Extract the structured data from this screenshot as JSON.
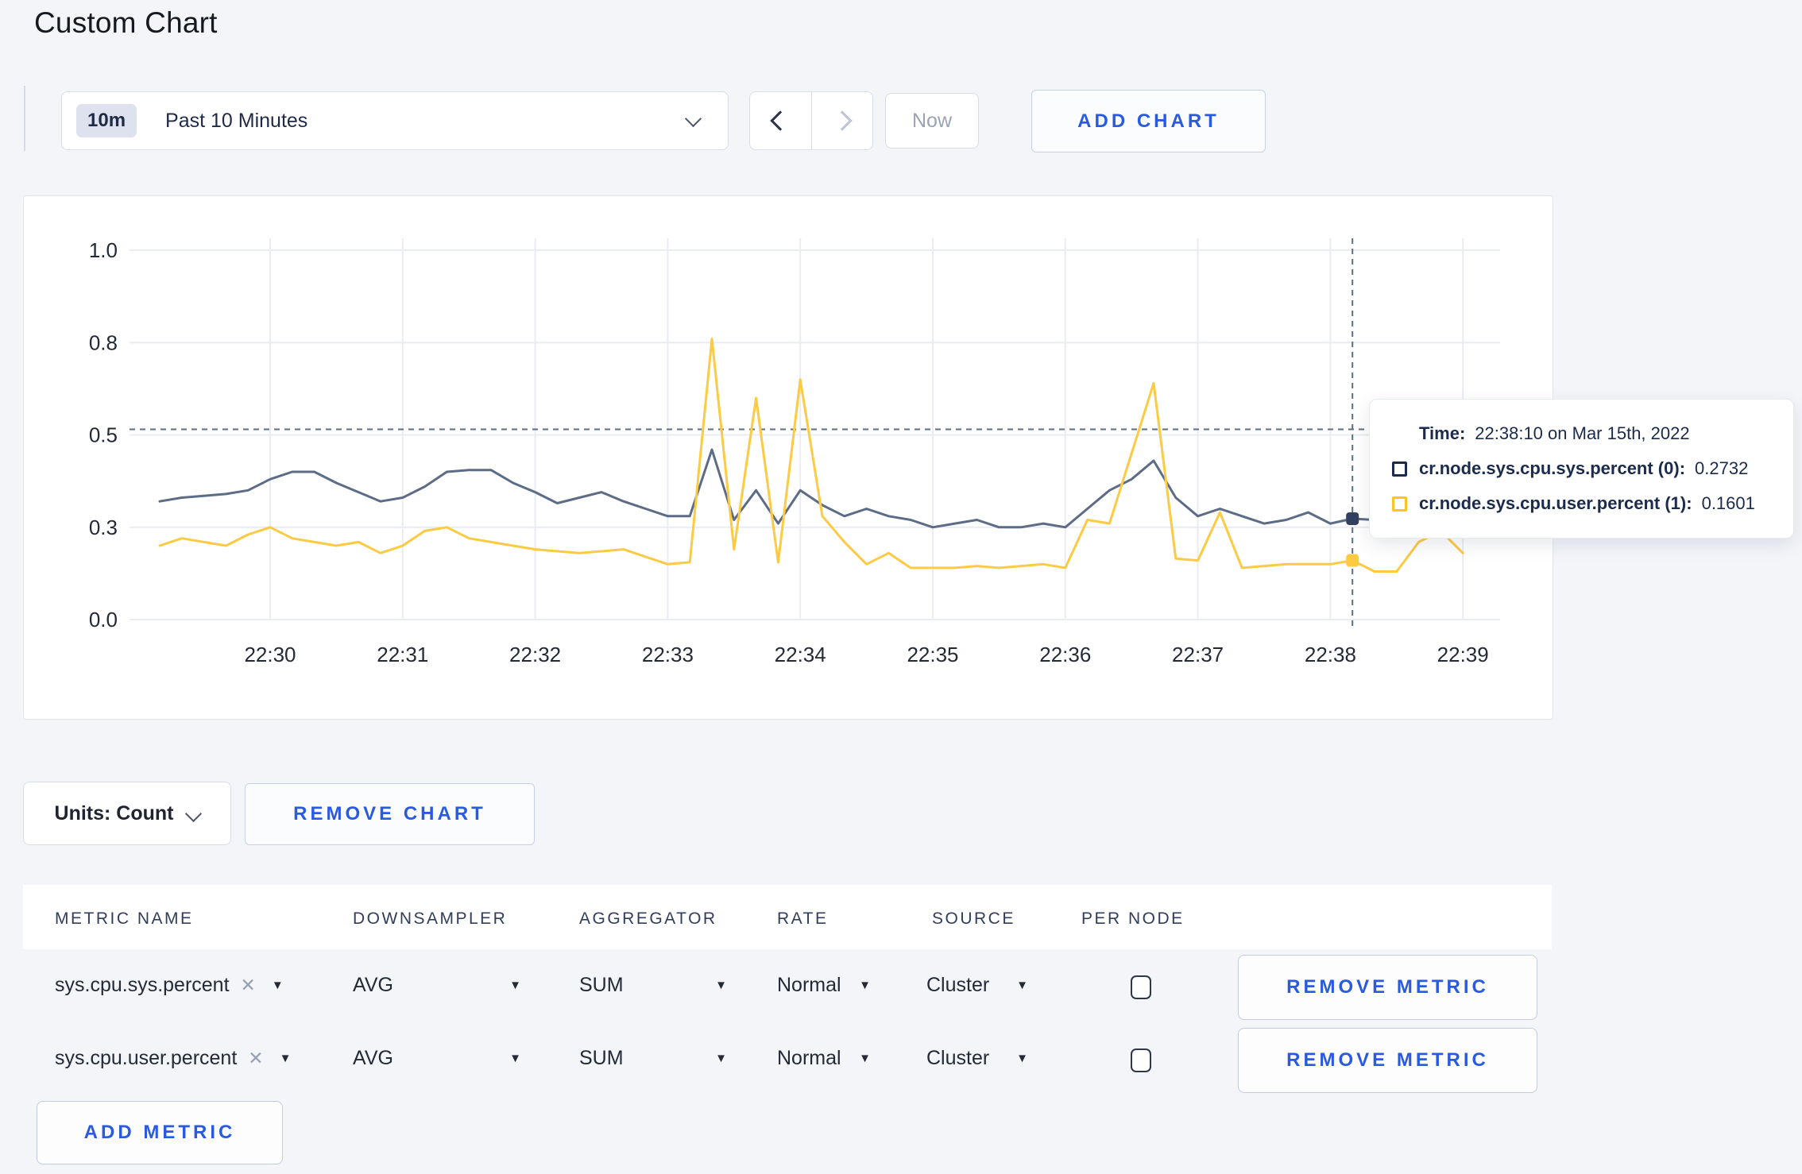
{
  "page": {
    "title": "Custom Chart"
  },
  "toolbar": {
    "time_window_badge": "10m",
    "time_window_label": "Past 10 Minutes",
    "now_label": "Now",
    "add_chart_label": "ADD CHART"
  },
  "chart_data": {
    "type": "line",
    "title": "",
    "xlabel": "",
    "ylabel": "",
    "ylim": [
      0,
      1
    ],
    "grid": true,
    "x_ticks": [
      "22:30",
      "22:31",
      "22:32",
      "22:33",
      "22:34",
      "22:35",
      "22:36",
      "22:37",
      "22:38",
      "22:39"
    ],
    "y_ticks": [
      {
        "label": "1.0",
        "value": 1.0
      },
      {
        "label": "0.8",
        "value": 0.75
      },
      {
        "label": "0.5",
        "value": 0.5
      },
      {
        "label": "0.3",
        "value": 0.25
      },
      {
        "label": "0.0",
        "value": 0.0
      }
    ],
    "crosshair": {
      "time": "22:38:10",
      "hover_value": 0.515
    },
    "series": [
      {
        "name": "cr.node.sys.cpu.sys.percent",
        "color": "#5d6c86",
        "marker_color": "#32415f",
        "points": [
          [
            "22:29:10",
            0.32
          ],
          [
            "22:29:20",
            0.33
          ],
          [
            "22:29:30",
            0.335
          ],
          [
            "22:29:40",
            0.34
          ],
          [
            "22:29:50",
            0.35
          ],
          [
            "22:30:00",
            0.38
          ],
          [
            "22:30:10",
            0.4
          ],
          [
            "22:30:20",
            0.4
          ],
          [
            "22:30:30",
            0.37
          ],
          [
            "22:30:40",
            0.345
          ],
          [
            "22:30:50",
            0.32
          ],
          [
            "22:31:00",
            0.33
          ],
          [
            "22:31:10",
            0.36
          ],
          [
            "22:31:20",
            0.4
          ],
          [
            "22:31:30",
            0.405
          ],
          [
            "22:31:40",
            0.405
          ],
          [
            "22:31:50",
            0.37
          ],
          [
            "22:32:00",
            0.345
          ],
          [
            "22:32:10",
            0.315
          ],
          [
            "22:32:20",
            0.33
          ],
          [
            "22:32:30",
            0.345
          ],
          [
            "22:32:40",
            0.32
          ],
          [
            "22:32:50",
            0.3
          ],
          [
            "22:33:00",
            0.28
          ],
          [
            "22:33:10",
            0.28
          ],
          [
            "22:33:20",
            0.46
          ],
          [
            "22:33:30",
            0.27
          ],
          [
            "22:33:40",
            0.35
          ],
          [
            "22:33:50",
            0.26
          ],
          [
            "22:34:00",
            0.35
          ],
          [
            "22:34:10",
            0.31
          ],
          [
            "22:34:20",
            0.28
          ],
          [
            "22:34:30",
            0.3
          ],
          [
            "22:34:40",
            0.28
          ],
          [
            "22:34:50",
            0.27
          ],
          [
            "22:35:00",
            0.25
          ],
          [
            "22:35:10",
            0.26
          ],
          [
            "22:35:20",
            0.27
          ],
          [
            "22:35:30",
            0.25
          ],
          [
            "22:35:40",
            0.25
          ],
          [
            "22:35:50",
            0.26
          ],
          [
            "22:36:00",
            0.25
          ],
          [
            "22:36:10",
            0.3
          ],
          [
            "22:36:20",
            0.35
          ],
          [
            "22:36:30",
            0.38
          ],
          [
            "22:36:40",
            0.43
          ],
          [
            "22:36:50",
            0.33
          ],
          [
            "22:37:00",
            0.28
          ],
          [
            "22:37:10",
            0.3
          ],
          [
            "22:37:20",
            0.28
          ],
          [
            "22:37:30",
            0.26
          ],
          [
            "22:37:40",
            0.27
          ],
          [
            "22:37:50",
            0.29
          ],
          [
            "22:38:00",
            0.26
          ],
          [
            "22:38:10",
            0.2732
          ],
          [
            "22:38:20",
            0.27
          ],
          [
            "22:38:30",
            0.28
          ],
          [
            "22:38:40",
            0.29
          ],
          [
            "22:38:50",
            0.3
          ],
          [
            "22:39:00",
            0.3
          ]
        ]
      },
      {
        "name": "cr.node.sys.cpu.user.percent",
        "color": "#fdca44",
        "marker_color": "#fdca44",
        "points": [
          [
            "22:29:10",
            0.2
          ],
          [
            "22:29:20",
            0.22
          ],
          [
            "22:29:30",
            0.21
          ],
          [
            "22:29:40",
            0.2
          ],
          [
            "22:29:50",
            0.23
          ],
          [
            "22:30:00",
            0.25
          ],
          [
            "22:30:10",
            0.22
          ],
          [
            "22:30:20",
            0.21
          ],
          [
            "22:30:30",
            0.2
          ],
          [
            "22:30:40",
            0.21
          ],
          [
            "22:30:50",
            0.18
          ],
          [
            "22:31:00",
            0.2
          ],
          [
            "22:31:10",
            0.24
          ],
          [
            "22:31:20",
            0.25
          ],
          [
            "22:31:30",
            0.22
          ],
          [
            "22:31:40",
            0.21
          ],
          [
            "22:31:50",
            0.2
          ],
          [
            "22:32:00",
            0.19
          ],
          [
            "22:32:10",
            0.185
          ],
          [
            "22:32:20",
            0.18
          ],
          [
            "22:32:30",
            0.185
          ],
          [
            "22:32:40",
            0.19
          ],
          [
            "22:32:50",
            0.17
          ],
          [
            "22:33:00",
            0.15
          ],
          [
            "22:33:10",
            0.155
          ],
          [
            "22:33:20",
            0.76
          ],
          [
            "22:33:30",
            0.19
          ],
          [
            "22:33:40",
            0.6
          ],
          [
            "22:33:50",
            0.155
          ],
          [
            "22:34:00",
            0.65
          ],
          [
            "22:34:10",
            0.28
          ],
          [
            "22:34:20",
            0.21
          ],
          [
            "22:34:30",
            0.15
          ],
          [
            "22:34:40",
            0.18
          ],
          [
            "22:34:50",
            0.14
          ],
          [
            "22:35:00",
            0.14
          ],
          [
            "22:35:10",
            0.14
          ],
          [
            "22:35:20",
            0.145
          ],
          [
            "22:35:30",
            0.14
          ],
          [
            "22:35:40",
            0.145
          ],
          [
            "22:35:50",
            0.15
          ],
          [
            "22:36:00",
            0.14
          ],
          [
            "22:36:10",
            0.27
          ],
          [
            "22:36:20",
            0.26
          ],
          [
            "22:36:30",
            0.45
          ],
          [
            "22:36:40",
            0.64
          ],
          [
            "22:36:50",
            0.165
          ],
          [
            "22:37:00",
            0.16
          ],
          [
            "22:37:10",
            0.29
          ],
          [
            "22:37:20",
            0.14
          ],
          [
            "22:37:30",
            0.145
          ],
          [
            "22:37:40",
            0.15
          ],
          [
            "22:37:50",
            0.15
          ],
          [
            "22:38:00",
            0.15
          ],
          [
            "22:38:10",
            0.1601
          ],
          [
            "22:38:20",
            0.13
          ],
          [
            "22:38:30",
            0.13
          ],
          [
            "22:38:40",
            0.21
          ],
          [
            "22:38:50",
            0.24
          ],
          [
            "22:39:00",
            0.18
          ]
        ]
      }
    ]
  },
  "tooltip": {
    "time_label": "Time:",
    "time_value": "22:38:10 on Mar 15th, 2022",
    "entries": [
      {
        "label": "cr.node.sys.cpu.sys.percent (0):",
        "value": "0.2732"
      },
      {
        "label": "cr.node.sys.cpu.user.percent (1):",
        "value": "0.1601"
      }
    ]
  },
  "chart_controls": {
    "units_label": "Units: Count",
    "remove_chart_label": "REMOVE CHART"
  },
  "metrics_table": {
    "headers": [
      "METRIC NAME",
      "DOWNSAMPLER",
      "AGGREGATOR",
      "RATE",
      "SOURCE",
      "PER NODE"
    ],
    "remove_icon": "✕",
    "caret_icon": "▼",
    "rows": [
      {
        "metric_name": "sys.cpu.sys.percent",
        "downsampler": "AVG",
        "aggregator": "SUM",
        "rate": "Normal",
        "source": "Cluster",
        "per_node_checked": false,
        "remove_label": "REMOVE METRIC"
      },
      {
        "metric_name": "sys.cpu.user.percent",
        "downsampler": "AVG",
        "aggregator": "SUM",
        "rate": "Normal",
        "source": "Cluster",
        "per_node_checked": false,
        "remove_label": "REMOVE METRIC"
      }
    ],
    "add_metric_label": "ADD METRIC"
  },
  "colors": {
    "accent_blue": "#2a5ae0",
    "series_sys": "#5d6c86",
    "series_user": "#fdca44",
    "page_background": "#f3f5f9"
  }
}
